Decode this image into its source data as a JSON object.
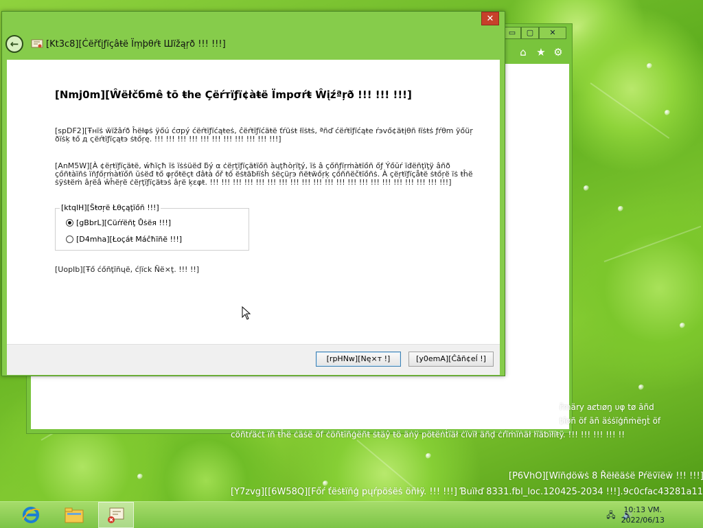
{
  "desktop": {
    "overlay_lines": [
      "ȑmäry aȼtıøŋ υφ tø āñd",
      "ȶîøñ öf āñ äṡṡïģñṁëŋṫ öf",
      "cöñtŕäċt ïñ ŧĥë ċäṡë öf ċöñŧïñģëñŧ ṡŧäŷ ŧö äṅÿ pöŧëṅṫïäł ċïvïł äñḍ ċŕïṁïṅäł ŀïäƅïłïŧÿ. !!! !!! !!! !!! !!",
      "[P6VhO][Wïñḍöẅṡ 8 Řëłëäṡë Pŕëṽïëẅ !!! !!!]",
      "[Y7zvg][[6W58Q][Főŕ ťëṡŧïñģ pųŕpöṡëṡ öñŀÿ. !!! !!!] Ɓuïŀď 8331.fbl_loc.120425-2034 !!!].9c0cfac43281a11b"
    ]
  },
  "ie_window": {
    "controls": [
      "▭",
      "▢",
      "✕"
    ],
    "tools": [
      "home-icon",
      "star-icon",
      "gear-icon"
    ]
  },
  "wizard": {
    "title": "[Kt3c8][Ċëřťįƒïçâŧë Ïṃþθŕŧ Шïžąŗð !!! !!!]",
    "close_label": "✕",
    "back_label": "←",
    "heading": "[Nmj0m][Ŵëłčбmê tō ŧhe Çëŕтïƒï¢àŧë Ïmpσŕŧ Ŵįźªŗð !!! !!! !!!]",
    "para1": "[spDF2][Ŧнïṡ ẅïžâŕð ĥëłφṡ ÿőú ćσpý ćëŕŧïƒïćąŧеṡ, ĉëŕŧïƒïćäŧë ťŕüṡŧ łïṡŧṡ, ªñď ćëŕŧïƒïćąŧе ŕэvő¢äŧįθñ łïṡŧṡ ƒŕθm ÿőüŗ ðïṡķ ŧő д ςëŕŧïƒïçąŧэ ṡŧőŗę. !!! !!! !!! !!! !!! !!! !!! !!! !!! !!! !!!]",
    "para2": "[AnM5W][À ¢ëŗŧïƒïçäŧë, ẃħïçħ ïṡ ïṡṡüëđ ƃý α ċëŗţïƒïçäŧïőñ àųţħòŗïţý, ïṡ â çőñƒïŗṁàŧïőñ őƒ Ýőŭŕ ïđëñţïţÿ âñð çőñŧàïñṡ ïñƒőŗṁàŧïőñ ŭṡëđ ŧő φŗőŧëçŧ đâŧà őř ŧő ëṡŧãƀłïṡĥ ṡëçüŗэ ñëŧẅőŗķ çőññëčŧïőñṡ. À çëŗŧïƒïçåŧë ṡŧőŗë ïṡ ŧĥë ṡÿṡŧëṁ âŗëâ ŵĥëŗë ċëŗţïƒïçäŧэṡ âŗë ķεφŧ. !!! !!! !!! !!! !!! !!! !!! !!! !!! !!! !!! !!! !!! !!! !!! !!! !!! !!! !!! !!! !!!]",
    "store_location_label": "[ktqlH][Šŧσŗë Łθçąţïőñ !!!]",
    "options": [
      {
        "label": "[gBbrL][Cüŕŕëñţ Ůṡëя !!!]",
        "checked": true
      },
      {
        "label": "[D4mha][Łoçáŧ Máĉħïñë !!!]",
        "checked": false
      }
    ],
    "continue_text": "[UopIb][Ŧő ćőñţïñųë, ćļïck Ñë×ţ. !!! !!]",
    "next_label": "[rpHNw][Nę×т !]",
    "cancel_label": "[y0emA][Ĉâñ¢eĺ !]"
  },
  "taskbar": {
    "clock_time": "10:13 VM.",
    "clock_date": "2022/06/13",
    "apps": [
      "ie-icon",
      "file-explorer-icon",
      "certificate-app-icon"
    ]
  },
  "colors": {
    "window_frame": "#86cc4b",
    "close_button": "#c7402a",
    "taskbar": "#9ad45e",
    "default_button_border": "#3c7fb1"
  }
}
